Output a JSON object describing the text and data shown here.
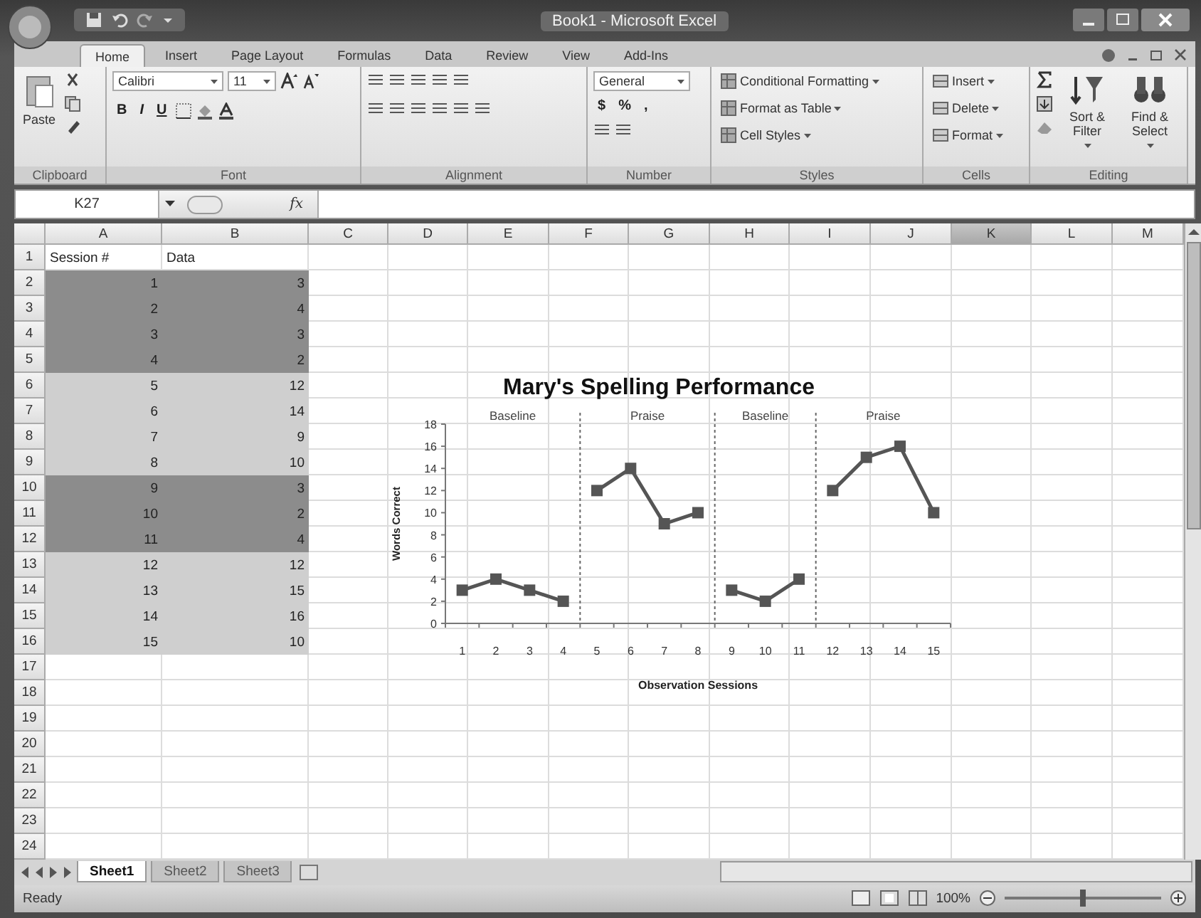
{
  "window": {
    "title": "Book1 - Microsoft Excel"
  },
  "ribbon": {
    "tabs": [
      {
        "label": "Home",
        "selected": true
      },
      {
        "label": "Insert",
        "selected": false
      },
      {
        "label": "Page Layout",
        "selected": false
      },
      {
        "label": "Formulas",
        "selected": false
      },
      {
        "label": "Data",
        "selected": false
      },
      {
        "label": "Review",
        "selected": false
      },
      {
        "label": "View",
        "selected": false
      },
      {
        "label": "Add-Ins",
        "selected": false
      }
    ],
    "clipboard": {
      "label": "Clipboard",
      "paste": "Paste"
    },
    "font": {
      "label": "Font",
      "name": "Calibri",
      "size": "11",
      "bold": "B",
      "italic": "I",
      "underline": "U"
    },
    "alignment": {
      "label": "Alignment"
    },
    "number": {
      "label": "Number",
      "format": "General",
      "currency": "$",
      "percent": "%",
      "comma": ","
    },
    "styles": {
      "label": "Styles",
      "items": [
        "Conditional Formatting",
        "Format as Table",
        "Cell Styles"
      ]
    },
    "cells": {
      "label": "Cells",
      "items": [
        "Insert",
        "Delete",
        "Format"
      ]
    },
    "editing": {
      "label": "Editing",
      "items": [
        "Sort & Filter",
        "Find & Select"
      ]
    }
  },
  "formula_bar": {
    "name_box": "K27",
    "function_label": "fx"
  },
  "sheet": {
    "columns": [
      {
        "label": "A",
        "selected": false
      },
      {
        "label": "B",
        "selected": false
      },
      {
        "label": "C",
        "selected": false
      },
      {
        "label": "D",
        "selected": false
      },
      {
        "label": "E",
        "selected": false
      },
      {
        "label": "F",
        "selected": false
      },
      {
        "label": "G",
        "selected": false
      },
      {
        "label": "H",
        "selected": false
      },
      {
        "label": "I",
        "selected": false
      },
      {
        "label": "J",
        "selected": false
      },
      {
        "label": "K",
        "selected": true
      },
      {
        "label": "L",
        "selected": false
      },
      {
        "label": "M",
        "selected": false
      }
    ],
    "rows": [
      {
        "number": "1",
        "kind": "text",
        "cells": [
          "Session #",
          "Data"
        ]
      },
      {
        "number": "2",
        "kind": "number",
        "cells": [
          "1",
          "3"
        ],
        "color": "#8c8c8c"
      },
      {
        "number": "3",
        "kind": "number",
        "cells": [
          "2",
          "4"
        ],
        "color": "#8c8c8c"
      },
      {
        "number": "4",
        "kind": "number",
        "cells": [
          "3",
          "3"
        ],
        "color": "#8c8c8c"
      },
      {
        "number": "5",
        "kind": "number",
        "cells": [
          "4",
          "2"
        ],
        "color": "#8c8c8c"
      },
      {
        "number": "6",
        "kind": "number",
        "cells": [
          "5",
          "12"
        ],
        "color": "#cfcfcf"
      },
      {
        "number": "7",
        "kind": "number",
        "cells": [
          "6",
          "14"
        ],
        "color": "#cfcfcf"
      },
      {
        "number": "8",
        "kind": "number",
        "cells": [
          "7",
          "9"
        ],
        "color": "#cfcfcf"
      },
      {
        "number": "9",
        "kind": "number",
        "cells": [
          "8",
          "10"
        ],
        "color": "#cfcfcf"
      },
      {
        "number": "10",
        "kind": "number",
        "cells": [
          "9",
          "3"
        ],
        "color": "#8c8c8c"
      },
      {
        "number": "11",
        "kind": "number",
        "cells": [
          "10",
          "2"
        ],
        "color": "#8c8c8c"
      },
      {
        "number": "12",
        "kind": "number",
        "cells": [
          "11",
          "4"
        ],
        "color": "#8c8c8c"
      },
      {
        "number": "13",
        "kind": "number",
        "cells": [
          "12",
          "12"
        ],
        "color": "#cfcfcf"
      },
      {
        "number": "14",
        "kind": "number",
        "cells": [
          "13",
          "15"
        ],
        "color": "#cfcfcf"
      },
      {
        "number": "15",
        "kind": "number",
        "cells": [
          "14",
          "16"
        ],
        "color": "#cfcfcf"
      },
      {
        "number": "16",
        "kind": "number",
        "cells": [
          "15",
          "10"
        ],
        "color": "#cfcfcf"
      },
      {
        "number": "17"
      },
      {
        "number": "18"
      },
      {
        "number": "19"
      },
      {
        "number": "20"
      },
      {
        "number": "21"
      },
      {
        "number": "22"
      },
      {
        "number": "23"
      },
      {
        "number": "24"
      }
    ],
    "chart": {
      "chart_data": {
        "type": "line",
        "title": "Mary's Spelling Performance",
        "xlabel": "Observation Sessions",
        "ylabel": "Words Correct",
        "categories": [
          "1",
          "2",
          "3",
          "4",
          "5",
          "6",
          "7",
          "8",
          "9",
          "10",
          "11",
          "12",
          "13",
          "14",
          "15"
        ],
        "series": [
          {
            "color": "#555555",
            "marker": "square",
            "values": [
              3,
              4,
              3,
              2,
              null,
              null,
              null,
              null,
              null,
              null,
              null,
              null,
              null,
              null,
              null
            ]
          },
          {
            "color": "#555555",
            "marker": "square",
            "values": [
              null,
              null,
              null,
              null,
              12,
              14,
              9,
              10,
              null,
              null,
              null,
              null,
              null,
              null,
              null
            ]
          },
          {
            "color": "#555555",
            "marker": "square",
            "values": [
              null,
              null,
              null,
              null,
              null,
              null,
              null,
              null,
              3,
              2,
              4,
              null,
              null,
              null,
              null
            ]
          },
          {
            "color": "#555555",
            "marker": "square",
            "values": [
              null,
              null,
              null,
              null,
              null,
              null,
              null,
              null,
              null,
              null,
              null,
              12,
              15,
              16,
              10
            ]
          }
        ],
        "annotations": [
          "Baseline",
          "Praise",
          "Baseline",
          "Praise"
        ],
        "ylim": [
          0,
          18
        ],
        "yticks": [
          0,
          2,
          4,
          6,
          8,
          10,
          12,
          14,
          16,
          18
        ]
      }
    }
  },
  "sheet_tabs": [
    {
      "label": "Sheet1",
      "selected": true
    },
    {
      "label": "Sheet2",
      "selected": false
    },
    {
      "label": "Sheet3",
      "selected": false
    }
  ],
  "status_bar": {
    "status": "Ready",
    "zoom": "100%",
    "zoom_slider": {
      "level": 0.5
    }
  }
}
